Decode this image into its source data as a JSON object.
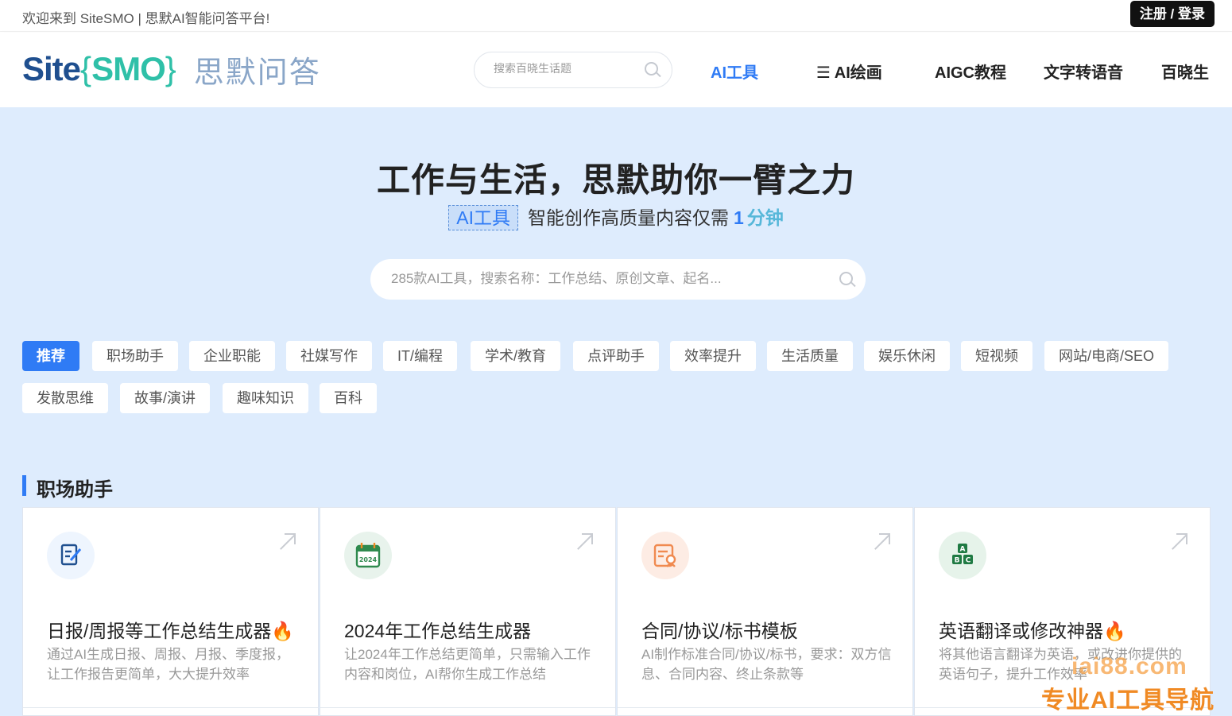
{
  "topbar": {
    "welcome": "欢迎来到 SiteSMO | 思默AI智能问答平台!",
    "login": "注册 / 登录"
  },
  "header": {
    "logo_site": "Site",
    "logo_smo": "SMO",
    "logo_cn": "思默问答",
    "search_placeholder": "搜索百晓生话题",
    "nav": [
      "AI工具",
      "☰ AI绘画",
      "AIGC教程",
      "文字转语音",
      "百晓生"
    ]
  },
  "hero": {
    "title": "工作与生活，思默助你一臂之力",
    "tag": "AI工具",
    "subtitle": "智能创作高质量内容仅需",
    "num": "1",
    "unit": "分钟",
    "search_placeholder": "285款AI工具，搜索名称：工作总结、原创文章、起名..."
  },
  "categories": [
    "推荐",
    "职场助手",
    "企业职能",
    "社媒写作",
    "IT/编程",
    "学术/教育",
    "点评助手",
    "效率提升",
    "生活质量",
    "娱乐休闲",
    "短视频",
    "网站/电商/SEO",
    "发散思维",
    "故事/演讲",
    "趣味知识",
    "百科"
  ],
  "section": {
    "title": "职场助手"
  },
  "cards": [
    {
      "title": "日报/周报等工作总结生成器🔥",
      "desc": "通过AI生成日报、周报、月报、季度报，让工作报告更简单，大大提升效率",
      "icon": "edit-doc-icon",
      "icon_label": ""
    },
    {
      "title": "2024年工作总结生成器",
      "desc": "让2024年工作总结更简单，只需输入工作内容和岗位，AI帮你生成工作总结",
      "icon": "calendar-icon",
      "icon_label": "2024"
    },
    {
      "title": "合同/协议/标书模板",
      "desc": "AI制作标准合同/协议/标书，要求：双方信息、合同内容、终止条款等",
      "icon": "contract-icon",
      "icon_label": ""
    },
    {
      "title": "英语翻译或修改神器🔥",
      "desc": "将其他语言翻译为英语，或改进你提供的英语句子，提升工作效率",
      "icon": "abc-blocks-icon",
      "icon_label": "A B C"
    }
  ],
  "watermark": {
    "line1": "iai88.com",
    "line2": "专业AI工具导航"
  },
  "colors": {
    "accent": "#2f7bf5",
    "hero_bg": "#deecfd",
    "logo_blue": "#1f4f8f",
    "logo_green": "#2fc0a8"
  }
}
